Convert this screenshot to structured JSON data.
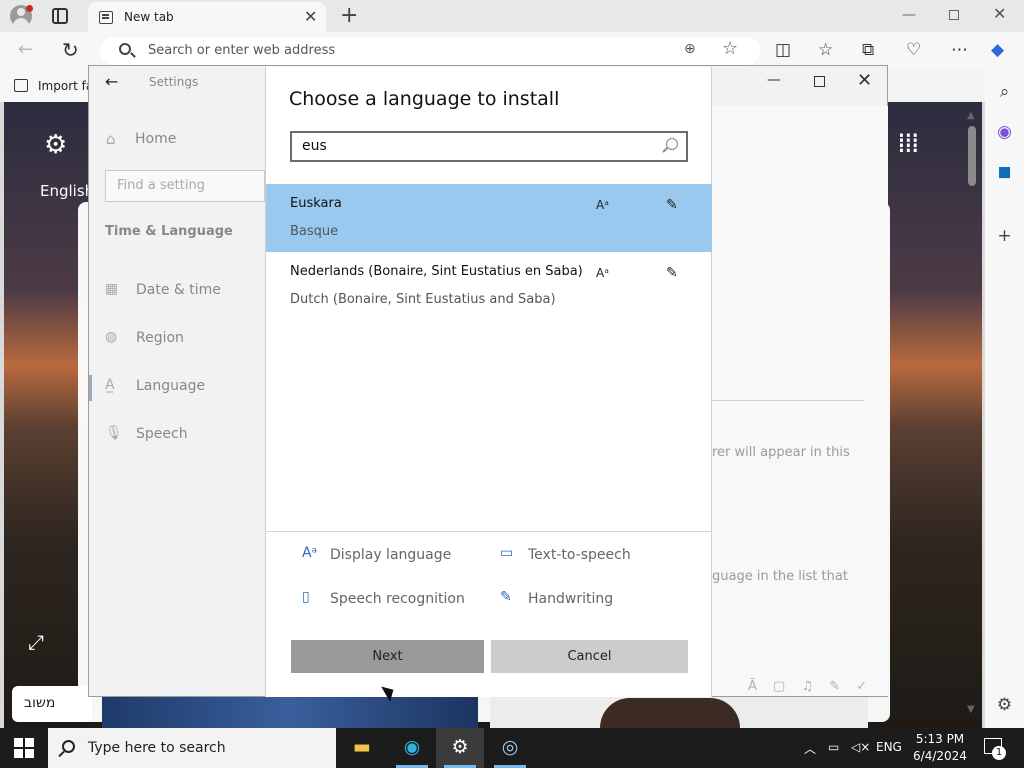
{
  "browser": {
    "tab_title": "New tab",
    "address_placeholder": "Search or enter web address",
    "favorites_import": "Import fa"
  },
  "background": {
    "english_label": "English",
    "pill_label": "משוב"
  },
  "settings": {
    "title": "Settings",
    "home": "Home",
    "find_placeholder": "Find a setting",
    "section": "Time & Language",
    "nav_items": [
      {
        "label": "Date & time",
        "icon": "calendar-icon"
      },
      {
        "label": "Region",
        "icon": "globe-icon"
      },
      {
        "label": "Language",
        "icon": "language-icon"
      },
      {
        "label": "Speech",
        "icon": "microphone-icon"
      }
    ],
    "right_text_1": "rer will appear in this",
    "right_text_2": "guage in the list that"
  },
  "dialog": {
    "title": "Choose a language to install",
    "search_value": "eus",
    "languages": [
      {
        "name": "Euskara",
        "sub": "Basque",
        "selected": true
      },
      {
        "name": "Nederlands (Bonaire, Sint Eustatius en Saba)",
        "sub": "Dutch (Bonaire, Sint Eustatius and Saba)",
        "selected": false
      }
    ],
    "features": {
      "display_language": "Display language",
      "text_to_speech": "Text-to-speech",
      "speech_recognition": "Speech recognition",
      "handwriting": "Handwriting"
    },
    "next_label": "Next",
    "cancel_label": "Cancel"
  },
  "taskbar": {
    "search_placeholder": "Type here to search",
    "language": "ENG",
    "time": "5:13 PM",
    "date": "6/4/2024",
    "notification_count": "1"
  },
  "colors": {
    "selection": "#99c9ee",
    "accent": "#2a6bb8",
    "taskbar": "#1c1c1c"
  }
}
